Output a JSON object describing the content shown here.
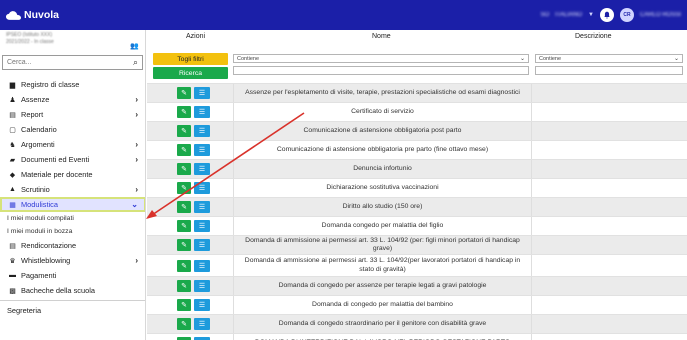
{
  "app": {
    "title": "Nuvola",
    "user_blurred": "CARLO ROSSI",
    "lang_blurred": "ITALIANO",
    "year_blurred": "SO"
  },
  "school": {
    "line1": "IPSEO (Istituto XXX)",
    "line2": "2021/2022 - In classe"
  },
  "search": {
    "placeholder": "Cerca...",
    "value": ""
  },
  "sidebar": {
    "items": [
      {
        "label": "Registro di classe",
        "icon": "book-icon",
        "chevron": false
      },
      {
        "label": "Assenze",
        "icon": "user-minus-icon",
        "chevron": true
      },
      {
        "label": "Report",
        "icon": "report-icon",
        "chevron": true
      },
      {
        "label": "Calendario",
        "icon": "calendar-icon",
        "chevron": false
      },
      {
        "label": "Argomenti",
        "icon": "users-icon",
        "chevron": true
      },
      {
        "label": "Documenti ed Eventi",
        "icon": "folder-icon",
        "chevron": true
      },
      {
        "label": "Materiale per docente",
        "icon": "share-icon",
        "chevron": false
      },
      {
        "label": "Scrutinio",
        "icon": "graduation-cap-icon",
        "chevron": true
      },
      {
        "label": "Modulistica",
        "icon": "forms-icon",
        "chevron": true,
        "active": true
      }
    ],
    "sub_items": [
      {
        "label": "I miei moduli compilati"
      },
      {
        "label": "I miei moduli in bozza"
      }
    ],
    "items_after": [
      {
        "label": "Rendicontazione",
        "icon": "clipboard-icon",
        "chevron": false
      },
      {
        "label": "Whistleblowing",
        "icon": "megaphone-icon",
        "chevron": true
      },
      {
        "label": "Pagamenti",
        "icon": "card-icon",
        "chevron": false
      },
      {
        "label": "Bacheche della scuola",
        "icon": "board-icon",
        "chevron": false
      }
    ],
    "section_label": "Segreteria"
  },
  "table": {
    "headers": {
      "actions": "Azioni",
      "name": "Nome",
      "description": "Descrizione"
    },
    "toggle_filters": "Togli filtri",
    "search_button": "Ricerca",
    "filter_name_value": "Contiene",
    "filter_desc_value": "Contiene",
    "rows": [
      {
        "name": "Assenze per l'espletamento di visite, terapie, prestazioni specialistiche od esami diagnostici"
      },
      {
        "name": "Certificato di servizio"
      },
      {
        "name": "Comunicazione di astensione obbligatoria post parto"
      },
      {
        "name": "Comunicazione di astensione obbligatoria pre parto (fine ottavo mese)"
      },
      {
        "name": "Denuncia infortunio"
      },
      {
        "name": "Dichiarazione sostitutiva vaccinazioni"
      },
      {
        "name": "Diritto allo studio (150 ore)"
      },
      {
        "name": "Domanda congedo per malattia del figlio"
      },
      {
        "name": "Domanda di ammissione ai permessi art. 33 L. 104/92 (per: figli minori portatori di handicap grave)"
      },
      {
        "name": "Domanda di ammissione ai permessi art. 33 L. 104/92(per lavoratori portatori di handicap in stato di gravità)"
      },
      {
        "name": "Domanda di congedo per assenze per terapie legati a gravi patologie"
      },
      {
        "name": "Domanda di congedo per malattia del bambino"
      },
      {
        "name": "Domanda di congedo straordinario per il genitore con disabilità grave"
      },
      {
        "name": "DOMANDA DI INTERDIZIONE DAL LAVORO NEL PERIODO GESTAZIONE PARTO"
      }
    ]
  },
  "colors": {
    "topbar": "#1b1fa8",
    "active_bg": "#e1e3ff",
    "active_text": "#2f3bd6",
    "yellow": "#f3c10e",
    "green": "#1aa94b",
    "blue": "#1e9bdc",
    "arrow": "#d9322b"
  }
}
